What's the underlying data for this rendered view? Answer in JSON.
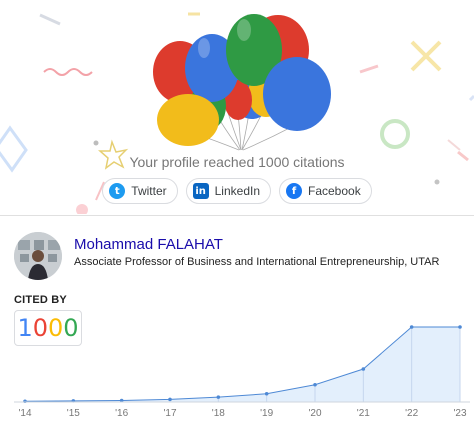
{
  "milestone": {
    "message": "Your profile reached 1000 citations"
  },
  "share": [
    {
      "label": "Twitter",
      "icon": "twitter-icon",
      "glyph": "t",
      "color": "#1d9bf0"
    },
    {
      "label": "LinkedIn",
      "icon": "linkedin-icon",
      "glyph": "in",
      "color": "#0a66c2"
    },
    {
      "label": "Facebook",
      "icon": "facebook-icon",
      "glyph": "f",
      "color": "#1877f2"
    }
  ],
  "profile": {
    "name": "Mohammad FALAHAT",
    "title": "Associate Professor of Business and International Entrepreneurship, UTAR"
  },
  "citations": {
    "label": "CITED BY",
    "count": "1000",
    "digit_colors": [
      "#4285f4",
      "#ea4335",
      "#fbbc05",
      "#34a853"
    ]
  },
  "colors": {
    "balloon_red": "#dd3b2d",
    "balloon_blue": "#3a75dd",
    "balloon_green": "#2f9a44",
    "balloon_yellow": "#f2bc1b",
    "chart_fill": "#e3effc",
    "chart_line": "#4e89d5"
  },
  "chart_data": {
    "type": "area",
    "x": [
      "'14",
      "'15",
      "'16",
      "'17",
      "'18",
      "'19",
      "'20",
      "'21",
      "'22",
      "'23"
    ],
    "values": [
      10,
      15,
      20,
      35,
      65,
      110,
      230,
      440,
      1000,
      1000
    ],
    "ylim": [
      0,
      1000
    ],
    "grid": false
  }
}
